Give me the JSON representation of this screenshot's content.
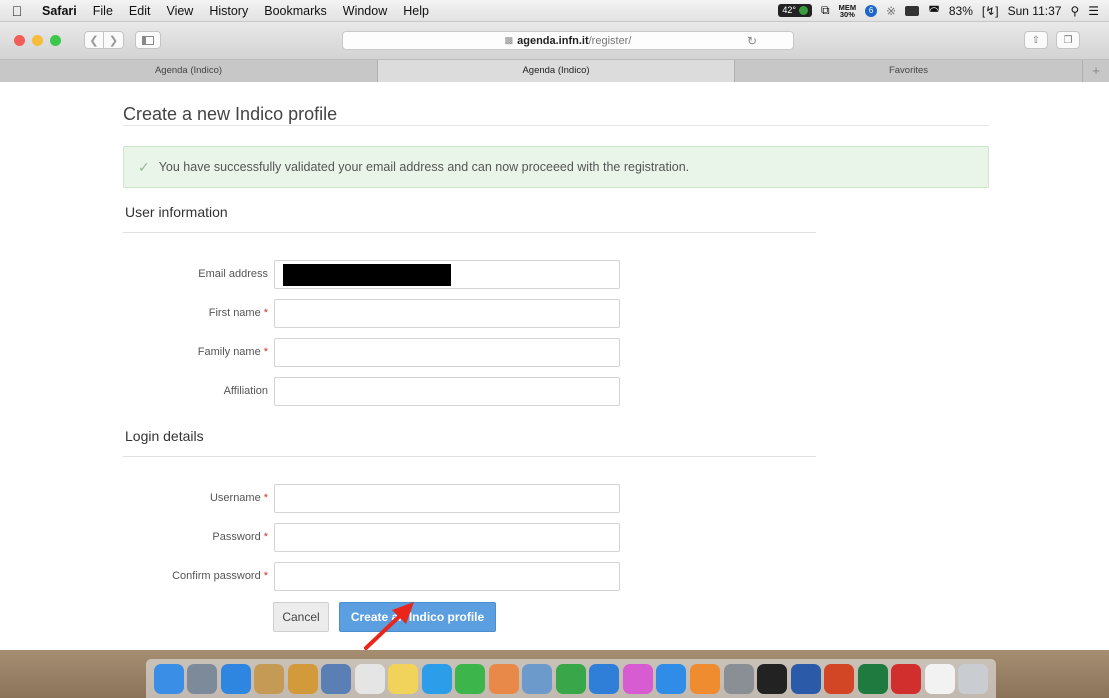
{
  "menubar": {
    "apple_icon": "apple-icon",
    "app": "Safari",
    "menus": [
      "File",
      "Edit",
      "View",
      "History",
      "Bookmarks",
      "Window",
      "Help"
    ],
    "status": {
      "temp": "42°",
      "mem_label": "MEM",
      "mem_value": "30%",
      "notif": "6",
      "battery": "83%",
      "clock": "Sun 11:37"
    }
  },
  "browser": {
    "url_host": "agenda.infn.it",
    "url_path": "/register/",
    "tabs": [
      "Agenda (Indico)",
      "Agenda (Indico)",
      "Favorites"
    ],
    "new_tab": "+"
  },
  "page": {
    "title": "Create a new Indico profile",
    "alert": "You have successfully validated your email address and can now proceeed with the registration.",
    "sections": {
      "user": "User information",
      "login": "Login details"
    },
    "required_mark": "*",
    "fields": {
      "email": "Email address",
      "first_name": "First name",
      "family_name": "Family name",
      "affiliation": "Affiliation",
      "username": "Username",
      "password": "Password",
      "confirm_password": "Confirm password"
    },
    "buttons": {
      "cancel": "Cancel",
      "create": "Create an Indico profile"
    }
  },
  "colors": {
    "accent": "#5b9fe0",
    "alert_bg": "#e9f5e8",
    "required": "#c0392b",
    "annotation_arrow": "#e8261b"
  },
  "dock": {
    "items": [
      {
        "icon": "finder-icon",
        "color": "#3a8ee6"
      },
      {
        "icon": "launchpad-icon",
        "color": "#7d8a99"
      },
      {
        "icon": "safari-icon",
        "color": "#2f86e0"
      },
      {
        "icon": "contacts-icon",
        "color": "#c49a55"
      },
      {
        "icon": "notes-book-icon",
        "color": "#d39a3c"
      },
      {
        "icon": "preview-icon",
        "color": "#5a7fb5"
      },
      {
        "icon": "calendar-icon",
        "color": "#e5e5e5"
      },
      {
        "icon": "notes-icon",
        "color": "#f1d35b"
      },
      {
        "icon": "messages-icon",
        "color": "#2c9ee9"
      },
      {
        "icon": "facetime-icon",
        "color": "#3cb54a"
      },
      {
        "icon": "photos-icon",
        "color": "#e8894a"
      },
      {
        "icon": "preview-photo-icon",
        "color": "#6c9acb"
      },
      {
        "icon": "numbers-icon",
        "color": "#3aa64a"
      },
      {
        "icon": "keynote-icon",
        "color": "#2f7fd9"
      },
      {
        "icon": "itunes-icon",
        "color": "#d75bd1"
      },
      {
        "icon": "app-store-icon",
        "color": "#2f8de8"
      },
      {
        "icon": "ibooks-icon",
        "color": "#ef8c2f"
      },
      {
        "icon": "system-preferences-icon",
        "color": "#8a8f96"
      },
      {
        "icon": "terminal-icon",
        "color": "#222222"
      },
      {
        "icon": "word-icon",
        "color": "#2b5aa8"
      },
      {
        "icon": "powerpoint-icon",
        "color": "#d24625"
      },
      {
        "icon": "excel-icon",
        "color": "#1f7a40"
      },
      {
        "icon": "parallels-icon",
        "color": "#d12e2e"
      },
      {
        "icon": "document-icon",
        "color": "#f2f2f2"
      },
      {
        "icon": "trash-icon",
        "color": "#c9cdd2"
      }
    ]
  }
}
